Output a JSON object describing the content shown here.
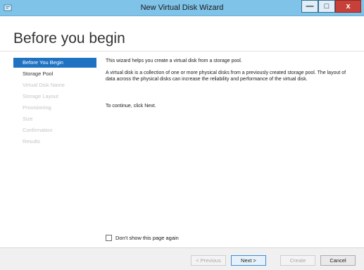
{
  "window": {
    "title": "New Virtual Disk Wizard",
    "minimize_glyph": "—",
    "maximize_glyph": "□",
    "close_glyph": "x",
    "icon": "wizard-app-icon"
  },
  "header": {
    "title": "Before you begin"
  },
  "nav": {
    "items": [
      {
        "label": "Before You Begin",
        "state": "active"
      },
      {
        "label": "Storage Pool",
        "state": "enabled"
      },
      {
        "label": "Virtual Disk Name",
        "state": "disabled"
      },
      {
        "label": "Storage Layout",
        "state": "disabled"
      },
      {
        "label": "Provisioning",
        "state": "disabled"
      },
      {
        "label": "Size",
        "state": "disabled"
      },
      {
        "label": "Confirmation",
        "state": "disabled"
      },
      {
        "label": "Results",
        "state": "disabled"
      }
    ]
  },
  "content": {
    "paragraphs": [
      "This wizard helps you create a virtual disk from a storage pool.",
      "A virtual disk is a collection of one or more physical disks from a previously created storage pool. The layout of data across the physical disks can increase the reliability and performance of the virtual disk.",
      "To continue, click Next."
    ]
  },
  "checkbox": {
    "label": "Don't show this page again",
    "checked": false
  },
  "buttons": {
    "previous": "< Previous",
    "next": "Next >",
    "create": "Create",
    "cancel": "Cancel"
  },
  "colors": {
    "titlebar": "#7fc3e8",
    "nav_active": "#1e72c2",
    "close_button": "#c7413a"
  }
}
